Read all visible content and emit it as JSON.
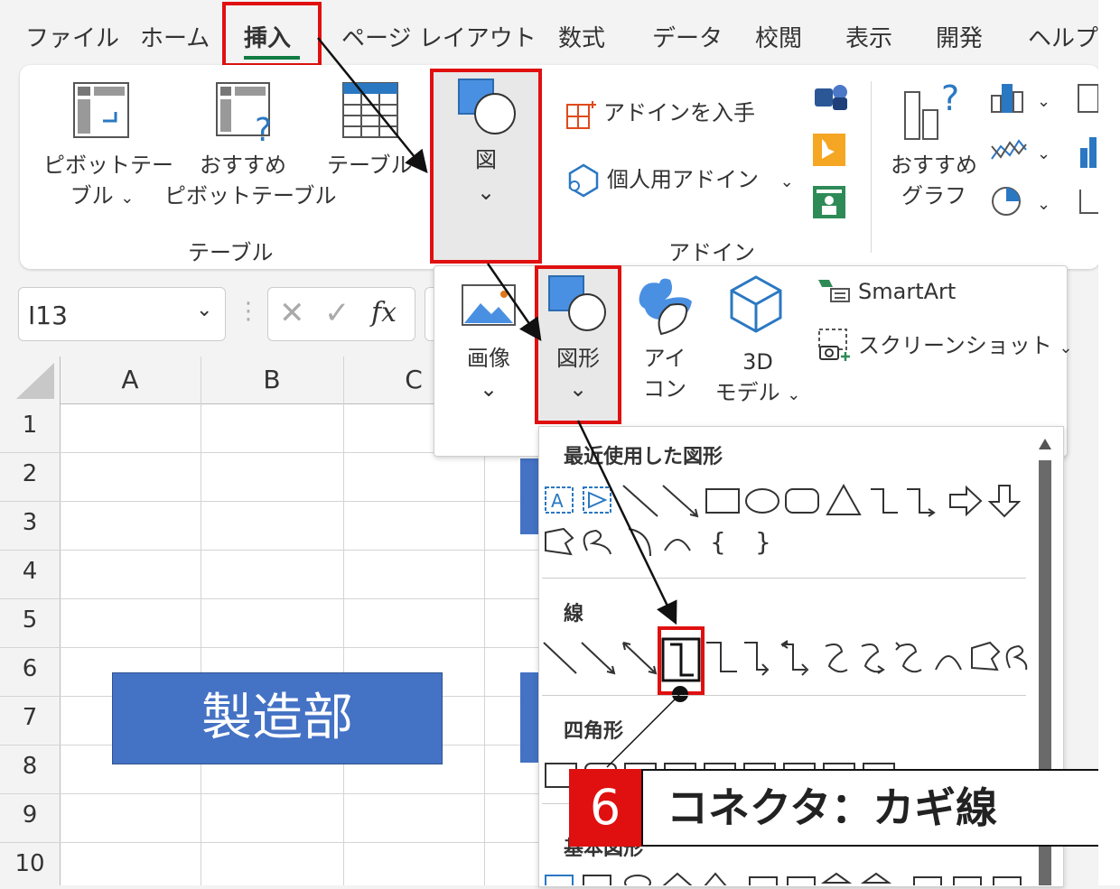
{
  "tabs": [
    "ファイル",
    "ホーム",
    "挿入",
    "ページ レイアウト",
    "数式",
    "データ",
    "校閲",
    "表示",
    "開発",
    "ヘルプ"
  ],
  "ribbon": {
    "pivot_table_1": "ピボットテー",
    "pivot_table_2": "ブル",
    "recommended_pivot_1": "おすすめ",
    "recommended_pivot_2": "ピボットテーブル",
    "table": "テーブル",
    "group_table": "テーブル",
    "illustrations": "図",
    "get_addins": "アドインを入手",
    "my_addins": "個人用アドイン",
    "group_addins": "アドイン",
    "recommended_chart_1": "おすすめ",
    "recommended_chart_2": "グラフ"
  },
  "formula_bar": {
    "name_box": "I13",
    "fx": "fx"
  },
  "columns": [
    "A",
    "B",
    "C"
  ],
  "rows": [
    "1",
    "2",
    "3",
    "4",
    "5",
    "6",
    "7",
    "8",
    "9",
    "10"
  ],
  "cell_shape_text": "製造部",
  "illustrations_menu": {
    "picture": "画像",
    "shapes": "図形",
    "icons_1": "アイ",
    "icons_2": "コン",
    "model_1": "3D",
    "model_2": "モデル",
    "smartart": "SmartArt",
    "screenshot": "スクリーンショット"
  },
  "shapes_gallery": {
    "recent": "最近使用した図形",
    "lines": "線",
    "rectangles": "四角形",
    "basic": "基本図形"
  },
  "callout": {
    "step": "6",
    "text": "コネクタ：カギ線"
  },
  "colors": {
    "accent_red": "#e01010",
    "shape_blue": "#4472c4",
    "excel_green": "#107c41"
  }
}
